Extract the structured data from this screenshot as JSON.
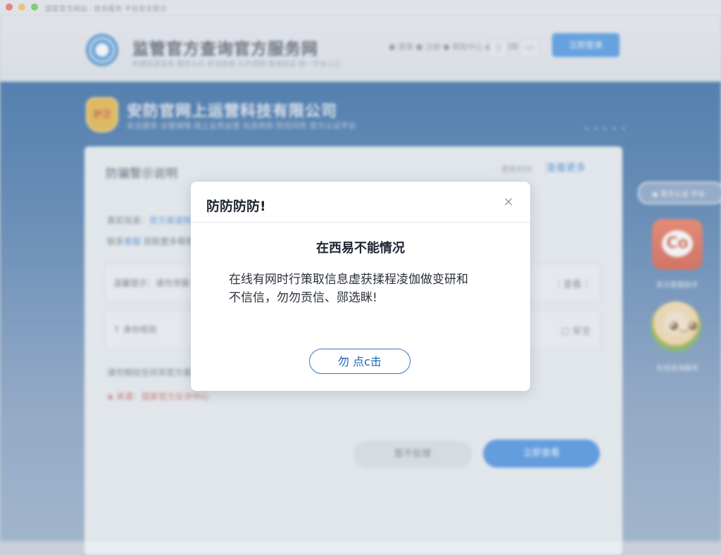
{
  "window": {
    "title": "国家官方网站 · 政务服务 平台安全提示"
  },
  "header": {
    "site_title": "监管官方查询官方服务网",
    "site_subtitle": "权威信息发布 服务公众 依法依规 公开透明 查询验证 统一平台入口",
    "link_text": "● 登录 ● 注册 ● 帮助中心 ● 无障碍",
    "icon_a": "▯",
    "icon_b": "▭",
    "action_button": "立即登录"
  },
  "banner": {
    "badge_text": "护卫",
    "company_name": "安防官网上运营科技有限公司",
    "company_subtitle": "安全服务 全面保障 线上业务运营 信息核验 防范风险 官方认证平台",
    "dots": "• • • • •"
  },
  "card": {
    "title": "防骗警示说明",
    "meta": "◦ 更新时间",
    "link": "查看更多",
    "line1_prefix": "真实信息：",
    "line1_link": "官方渠道核验",
    "line2_prefix": "联系",
    "line2_link": "客服",
    "line2_suffix": " 获取更多帮助信息",
    "row1_text": "温馨提示：请勿泄露个人验证码",
    "row1_side": "｜查看｜",
    "row2_text": "↑ 身份核验",
    "row2_side": "▢ 安全",
    "row3_text": "请勿相信任何非官方渠道的信息，谨防上当",
    "row3_sub": "◈ 来源：国家官方反诈中心",
    "btn_cancel": "暂不处理",
    "btn_confirm": "立即查看"
  },
  "side": {
    "pill_text": "◉ 官方认证 平台",
    "app1_glyph": "Co",
    "app1_label": "官方客服助手",
    "app2_label": "在线咨询服务",
    "app2_face": "◕‿◕"
  },
  "modal": {
    "title": "防防防防!",
    "close_icon": "×",
    "heading": "在西易不能情况",
    "body_line1": "在线有网时行策取信息虚获揉程凌伽做变研和",
    "body_line2": "不信信，勿勿贡信、郧选眯!",
    "button": "勿  点c击"
  },
  "colors": {
    "accent_blue": "#2f79c8",
    "banner_blue": "#1f5b9b",
    "primary_button": "#3585df",
    "app_tile_red": "#d24a33"
  }
}
